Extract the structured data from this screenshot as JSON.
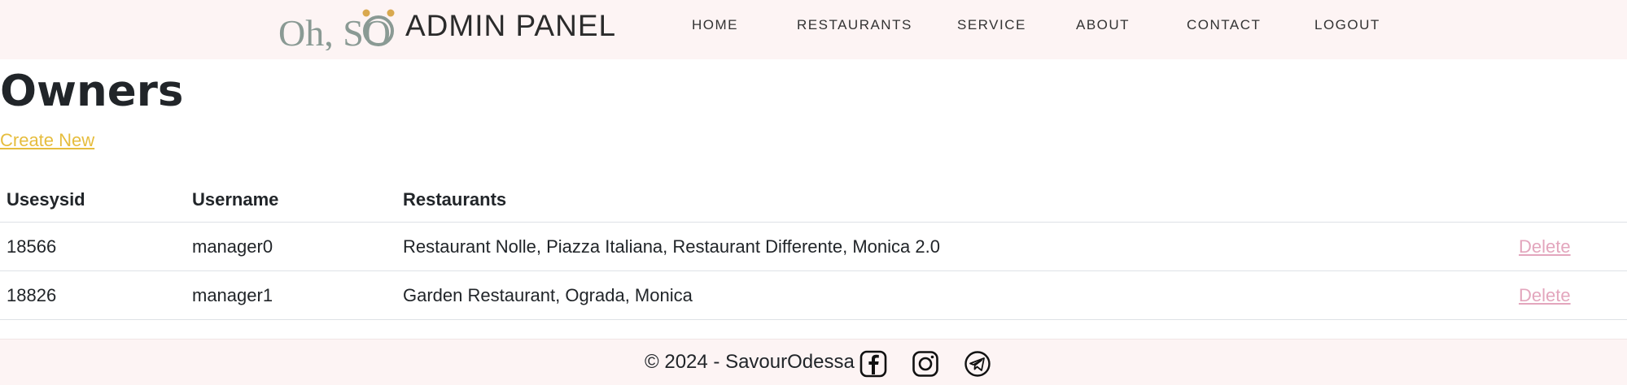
{
  "brand": {
    "logo_text": "Oh, SO",
    "title": "ADMIN PANEL"
  },
  "nav": {
    "items": [
      {
        "label": "HOME"
      },
      {
        "label": "RESTAURANTS"
      },
      {
        "label": "SERVICE"
      },
      {
        "label": "ABOUT"
      },
      {
        "label": "CONTACT"
      },
      {
        "label": "LOGOUT"
      }
    ]
  },
  "main": {
    "title": "Owners",
    "create_link": "Create New",
    "table": {
      "headers": [
        "Usesysid",
        "Username",
        "Restaurants"
      ],
      "rows": [
        {
          "usesysid": "18566",
          "username": "manager0",
          "restaurants": "Restaurant Nolle, Piazza Italiana, Restaurant Differente, Monica 2.0",
          "action": "Delete"
        },
        {
          "usesysid": "18826",
          "username": "manager1",
          "restaurants": "Garden Restaurant, Ograda, Monica",
          "action": "Delete"
        }
      ]
    }
  },
  "footer": {
    "copyright": "© 2024 - SavourOdessa",
    "social_icons": [
      "facebook-icon",
      "instagram-icon",
      "telegram-icon"
    ]
  },
  "colors": {
    "header_bg": "#fdf4f4",
    "link_yellow": "#e6bd3e",
    "delete_pink": "#e3a6bd",
    "logo_gold": "#d9a94f"
  }
}
